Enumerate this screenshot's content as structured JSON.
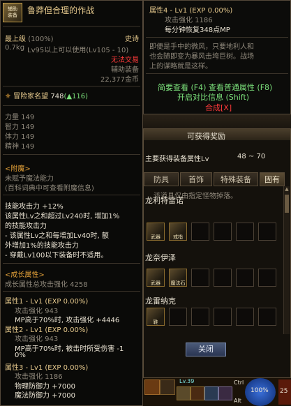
{
  "left": {
    "item_name": "鲁莽但合理的作战",
    "icon_label": "辅助\n装备",
    "max_level_label": "最上级",
    "max_level_pct": "(100%)",
    "rarity": "史诗",
    "weight": "0.7kg",
    "level_req": "Lv95以上可以使用(Lv105 - 10)",
    "trade": "无法交易",
    "category": "辅助装备",
    "price": "22,377金币",
    "fame_label": "冒险家名望",
    "fame_value": "748",
    "fame_delta": "(▲116)",
    "stats": [
      "力量 149",
      "智力 149",
      "体力 149",
      "精神 149"
    ],
    "enchant_header": "<附魔>",
    "enchant_none": "未赋予魔法能力",
    "enchant_hint": "(百科词典中可查看附魔信息)",
    "skill_lines": [
      "技能攻击力 +12%",
      "该属性Lv之和超过Lv240时, 增加1%",
      "的技能攻击力",
      "- 该属性Lv之和每增加Lv40时, 额",
      "外增加1%的技能攻击力",
      "- 穿戴Lv100以下装备时不适用。"
    ],
    "growth_header": "<成长属性>",
    "growth_total": "成长属性总攻击强化 4258",
    "growth_lines": [
      {
        "text": "属性1 - Lv1 (EXP 0.00%)",
        "cls": "gold"
      },
      {
        "text": "攻击强化 943",
        "cls": "gray ind"
      },
      {
        "text": "MP高于70%时, 攻击强化 +4446",
        "cls": "white ind"
      },
      {
        "text": "属性2 - Lv1 (EXP 0.00%)",
        "cls": "gold"
      },
      {
        "text": "攻击强化 943",
        "cls": "gray ind"
      },
      {
        "text": "MP高于70%时, 被击时所受伤害 -1",
        "cls": "white ind"
      },
      {
        "text": "0%",
        "cls": "white ind"
      },
      {
        "text": "属性3 - Lv1 (EXP 0.00%)",
        "cls": "gold"
      },
      {
        "text": "攻击强化 1186",
        "cls": "gray ind"
      },
      {
        "text": "物理防御力 +7000",
        "cls": "white ind"
      },
      {
        "text": "魔法防御力 +7000",
        "cls": "white ind"
      }
    ]
  },
  "right_tooltip": {
    "attr4": "属性4 - Lv1 (EXP 0.00%)",
    "attr4_atk": "攻击强化 1186",
    "attr4_mp": "每分钟恢复348点MP",
    "flavor": [
      "即便是手中的微风，只要地利人和",
      "也会随即变为暴风击垮巨树。战场",
      "上的谋略就是这样。"
    ],
    "simple_view": "简要查看 (F4) 查看普通属性 (F8)",
    "open_compare": "开启对比信息 (Shift)",
    "compose": "合成[X]"
  },
  "obtainable": {
    "title": "可获得奖励",
    "main_attr_label": "主要获得装备属性Lv",
    "main_attr_range": "48 ~ 70",
    "tabs": [
      "防具",
      "首饰",
      "特殊装备",
      "固有"
    ],
    "notice": "该道具仅由指定怪物掉落。",
    "monsters": [
      {
        "name": "龙利特雷诺",
        "items": [
          "武器",
          "戒指"
        ]
      },
      {
        "name": "龙奈伊泽",
        "items": [
          "武器",
          "魔法石"
        ]
      },
      {
        "name": "龙雷纳克",
        "items": [
          "鞋"
        ]
      }
    ],
    "close_label": "关闭"
  },
  "hud": {
    "hp_pct": "100%",
    "level": "Lv.39",
    "shortcut_ctrl": "Ctrl",
    "num": "25",
    "alt": "Alt"
  }
}
